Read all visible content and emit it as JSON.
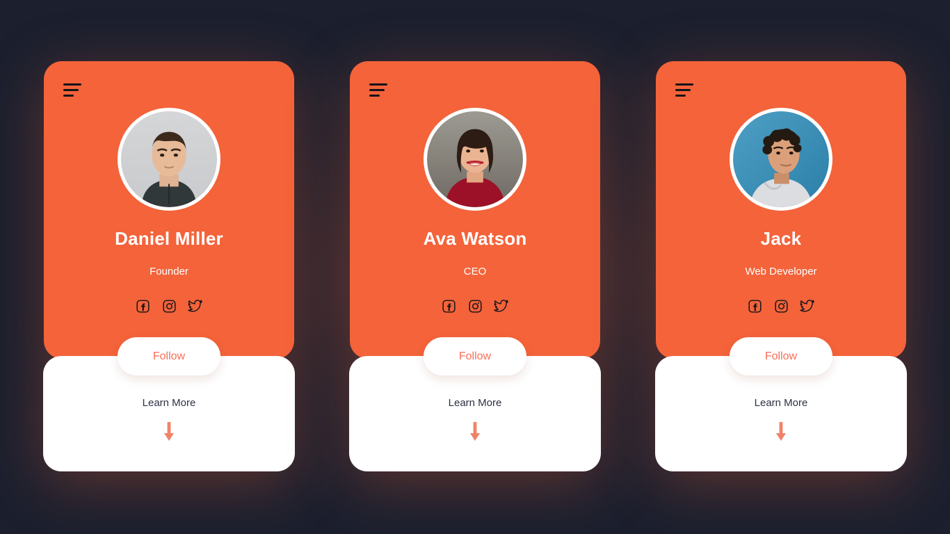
{
  "theme": {
    "background": "#1b1f2e",
    "card_orange": "#f4633a",
    "card_white": "#ffffff",
    "follow_text": "#fa6e55",
    "learn_more_text": "#2b3142",
    "arrow_color": "#f08268",
    "icon_color": "#12131a"
  },
  "icons": {
    "menu": "hamburger-menu-icon",
    "facebook": "facebook-icon",
    "instagram": "instagram-icon",
    "twitter": "twitter-icon",
    "arrow": "arrow-down-icon"
  },
  "cards": [
    {
      "menu_label": "Menu",
      "avatar_alt": "Daniel Miller portrait",
      "name": "Daniel Miller",
      "role": "Founder",
      "socials": [
        "Facebook",
        "Instagram",
        "Twitter"
      ],
      "follow_label": "Follow",
      "learn_more_label": "Learn More"
    },
    {
      "menu_label": "Menu",
      "avatar_alt": "Ava Watson portrait",
      "name": "Ava Watson",
      "role": "CEO",
      "socials": [
        "Facebook",
        "Instagram",
        "Twitter"
      ],
      "follow_label": "Follow",
      "learn_more_label": "Learn More"
    },
    {
      "menu_label": "Menu",
      "avatar_alt": "Jack portrait",
      "name": "Jack",
      "role": "Web Developer",
      "socials": [
        "Facebook",
        "Instagram",
        "Twitter"
      ],
      "follow_label": "Follow",
      "learn_more_label": "Learn More"
    }
  ]
}
